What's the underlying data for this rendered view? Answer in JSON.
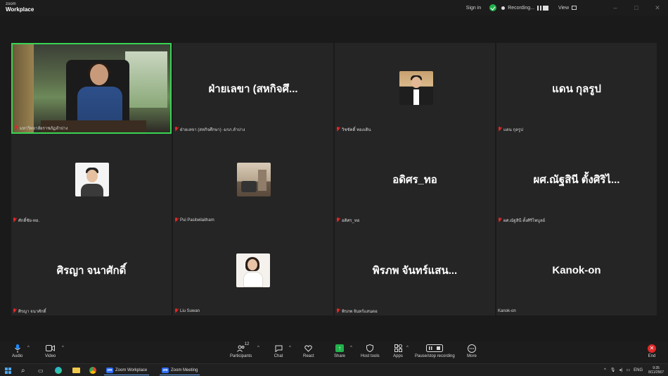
{
  "app": {
    "brand_top": "zoom",
    "brand_main": "Workplace"
  },
  "titlebar": {
    "signin": "Sign in",
    "recording": "Recording...",
    "view": "View",
    "icons": [
      "shield-check-icon",
      "recording-dot-icon",
      "pause-icon",
      "stop-icon",
      "grid-icon",
      "minimize-icon",
      "maximize-icon",
      "close-icon"
    ],
    "accent": "#22b14c"
  },
  "tiles": [
    {
      "display": "",
      "label": "มหาวิทยาลัยราชภัฏลำปาง",
      "muted": true,
      "video": true
    },
    {
      "display": "ฝ่ายเลขา (สหกิจศึ...",
      "label": "ฝ่ายเลขา (สหกิจศึกษา) -มรภ.ลำปาง",
      "muted": true
    },
    {
      "display": "",
      "label": "วิชชัคดิ์ ทองเดิน",
      "muted": true,
      "photo": "suit"
    },
    {
      "display": "แดน กุลรูป",
      "label": "แดน กุลรูป",
      "muted": true
    },
    {
      "display": "",
      "label": "ศักดิ์ชัย-ทอ.",
      "muted": true,
      "photo": "glasses"
    },
    {
      "display": "",
      "label": "Pui Pasitwilaitham",
      "muted": true,
      "photo": "room"
    },
    {
      "display": "อดิศร_ทอ",
      "label": "อดิศร_ทอ",
      "muted": true
    },
    {
      "display": "ผศ.ณัฐสินี ตั้งศิริไ...",
      "label": "ผศ.ณัฐสินี ตั้งศิริไพบูลย์",
      "muted": true
    },
    {
      "display": "ศิรญา จนาศักดิ์",
      "label": "ศิรญา จนาศักดิ์",
      "muted": true
    },
    {
      "display": "",
      "label": "Liu Suwan",
      "muted": true,
      "photo": "woman"
    },
    {
      "display": "พิรภพ จันทร์แสน...",
      "label": "พิรภพ จันทร์แสนตอ",
      "muted": true
    },
    {
      "display": "Kanok-on",
      "label": "Kanok-on",
      "muted": false
    }
  ],
  "toolbar": {
    "audio": "Audio",
    "video": "Video",
    "participants": "Participants",
    "participants_count": "12",
    "chat": "Chat",
    "react": "React",
    "share": "Share",
    "host_tools": "Host tools",
    "apps": "Apps",
    "recording": "Pause/stop recording",
    "more": "More",
    "end": "End",
    "end_color": "#e02828"
  },
  "taskbar": {
    "apps": [
      {
        "label": "Zoom Workplace",
        "icon": "zoom-icon"
      },
      {
        "label": "Zoom Meeting",
        "icon": "zoom-icon"
      }
    ],
    "lang": "ENG",
    "time": "9:35",
    "date": "8/11/2567"
  }
}
